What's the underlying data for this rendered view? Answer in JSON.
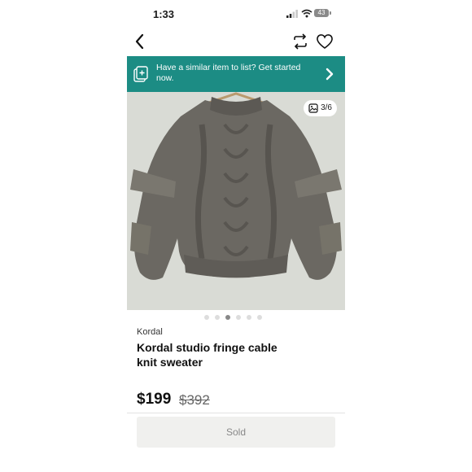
{
  "status_bar": {
    "time": "1:33",
    "battery": "43"
  },
  "banner": {
    "text": "Have a similar item to list? Get started now."
  },
  "gallery": {
    "counter": "3/6",
    "active_index": 2,
    "total": 6
  },
  "product": {
    "brand": "Kordal",
    "title": "Kordal studio fringe cable knit sweater",
    "price": "$199",
    "original_price": "$392",
    "status_button": "Sold"
  },
  "colors": {
    "banner": "#1c8c84",
    "sweater": "#6b6862",
    "background": "#d9dbd5"
  }
}
